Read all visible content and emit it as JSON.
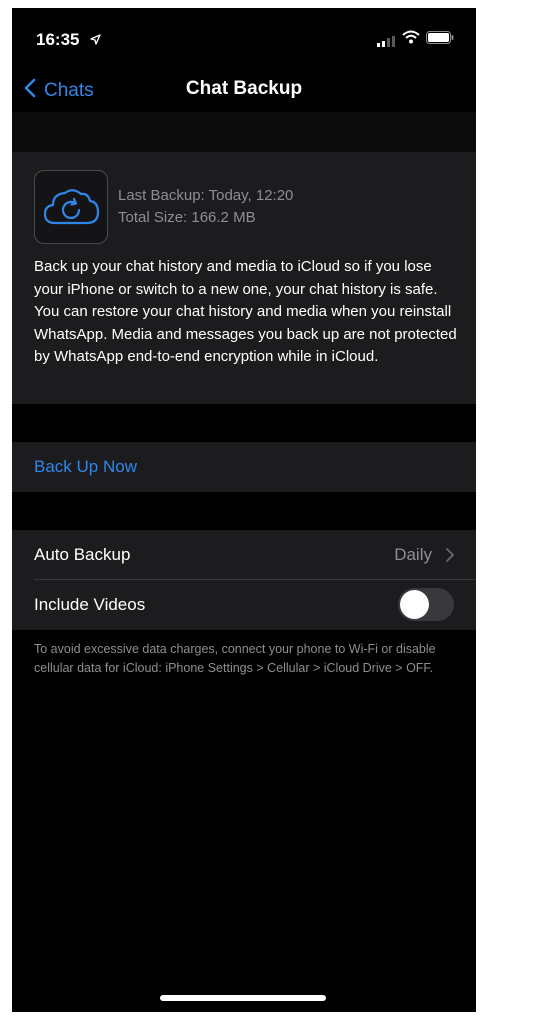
{
  "status_bar": {
    "time": "16:35"
  },
  "nav": {
    "back_label": "Chats",
    "title": "Chat Backup"
  },
  "backup_info": {
    "last_backup": "Last Backup: Today, 12:20",
    "total_size": "Total Size: 166.2 MB",
    "description": "Back up your chat history and media to iCloud so if you lose your iPhone or switch to a new one, your chat history is safe. You can restore your chat history and media when you reinstall WhatsApp. Media and messages you back up are not protected by WhatsApp end-to-end encryption while in iCloud."
  },
  "actions": {
    "backup_now": "Back Up Now"
  },
  "settings": {
    "auto_backup_label": "Auto Backup",
    "auto_backup_value": "Daily",
    "include_videos_label": "Include Videos",
    "include_videos_on": false
  },
  "footnote": "To avoid excessive data charges, connect your phone to Wi-Fi or disable cellular data for iCloud: iPhone Settings > Cellular > iCloud Drive > OFF.",
  "colors": {
    "accent": "#2e87e8",
    "background": "#000000",
    "cell": "#1c1c1e",
    "secondary_text": "#8e8e93"
  },
  "icons": [
    "location-arrow-icon",
    "signal-icon",
    "wifi-icon",
    "battery-icon",
    "back-chevron-icon",
    "icloud-backup-icon",
    "chevron-right-icon"
  ]
}
